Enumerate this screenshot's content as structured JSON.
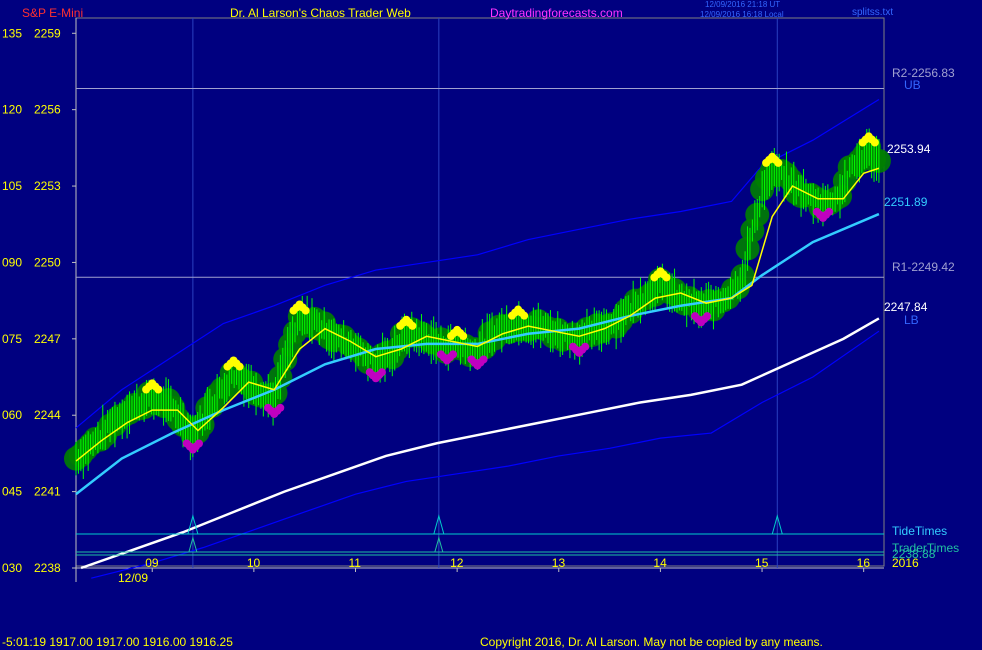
{
  "header": {
    "instrument": "S&P E-Mini",
    "site_title": "Dr. Al Larson's Chaos Trader Web",
    "site_link": "Daytradingforecasts.com",
    "timestamp_ut": "12/09/2016 21:18 UT",
    "timestamp_local": "12/09/2016 16:18 Local",
    "file_name": "splitss.txt"
  },
  "footer": {
    "status_line": "-5:01:19  1917.00 1917.00 1916.00 1916.25",
    "copyright": "Copyright 2016, Dr. Al Larson. May not be copied by any means."
  },
  "colors": {
    "background": "#000080",
    "axis": "#808080",
    "price_candles": "#00ff00",
    "glow": "#008000",
    "upper_dots": "#ffff00",
    "lower_dots": "#c000c0",
    "fast_ema": "#ffff00",
    "mid_ema": "#33ccff",
    "slow_ema": "#ffffff",
    "bands": "#0000ff",
    "pivot_lines": "#a0a0d0",
    "tide_line": "#00cccc",
    "trader_line": "#20c0a0",
    "accent_red": "#ff3030",
    "link_magenta": "#ff33ff"
  },
  "chart_data": {
    "type": "line",
    "title": "S&P E-Mini",
    "x_ticks": [
      "09",
      "10",
      "11",
      "12",
      "13",
      "14",
      "15",
      "16"
    ],
    "x_date_label": "12/09",
    "x_year_label": "2016",
    "xlim": [
      8.25,
      16.2
    ],
    "ylim": [
      2238,
      2259.6
    ],
    "y_ticks": [
      {
        "left": "135",
        "right": "2259",
        "value": 2259
      },
      {
        "left": "120",
        "right": "2256",
        "value": 2256
      },
      {
        "left": "105",
        "right": "2253",
        "value": 2253
      },
      {
        "left": "090",
        "right": "2250",
        "value": 2250
      },
      {
        "left": "075",
        "right": "2247",
        "value": 2247
      },
      {
        "left": "060",
        "right": "2244",
        "value": 2244
      },
      {
        "left": "045",
        "right": "2241",
        "value": 2241
      },
      {
        "left": "030",
        "right": "2238",
        "value": 2238
      }
    ],
    "pivot_levels": [
      {
        "label": "R2-2256.83",
        "value": 2256.83
      },
      {
        "label": "R1-2249.42",
        "value": 2249.42
      }
    ],
    "band_labels": {
      "upper": "UB",
      "lower": "LB"
    },
    "series": [
      {
        "name": "price",
        "label": "2253.94",
        "x": [
          8.25,
          8.4,
          8.6,
          8.8,
          9.0,
          9.2,
          9.4,
          9.6,
          9.8,
          10.0,
          10.2,
          10.3,
          10.45,
          10.6,
          10.8,
          11.0,
          11.2,
          11.35,
          11.5,
          11.7,
          11.9,
          12.0,
          12.2,
          12.4,
          12.6,
          12.8,
          13.0,
          13.2,
          13.4,
          13.6,
          13.8,
          14.0,
          14.2,
          14.4,
          14.6,
          14.8,
          15.0,
          15.1,
          15.25,
          15.45,
          15.6,
          15.75,
          15.9,
          16.05,
          16.15
        ],
        "values": [
          2242.3,
          2242.8,
          2243.7,
          2244.3,
          2244.7,
          2244.3,
          2243.2,
          2244.6,
          2245.6,
          2245.1,
          2244.6,
          2246.1,
          2247.8,
          2247.7,
          2247.0,
          2246.7,
          2246.0,
          2246.4,
          2247.2,
          2247.0,
          2246.7,
          2246.8,
          2246.5,
          2247.4,
          2247.6,
          2247.5,
          2247.2,
          2247.0,
          2247.4,
          2247.8,
          2248.6,
          2249.1,
          2248.5,
          2248.2,
          2248.5,
          2249.4,
          2252.8,
          2253.6,
          2253.2,
          2252.6,
          2252.3,
          2252.6,
          2253.8,
          2254.4,
          2253.9
        ]
      },
      {
        "name": "fast EMA",
        "x": [
          8.25,
          8.5,
          8.75,
          9.0,
          9.25,
          9.45,
          9.7,
          9.95,
          10.2,
          10.45,
          10.7,
          10.95,
          11.2,
          11.45,
          11.7,
          11.95,
          12.2,
          12.45,
          12.7,
          12.95,
          13.2,
          13.45,
          13.7,
          13.95,
          14.2,
          14.45,
          14.7,
          14.9,
          15.1,
          15.3,
          15.55,
          15.8,
          16.0,
          16.15
        ],
        "values": [
          2242.2,
          2243.0,
          2243.7,
          2244.2,
          2244.2,
          2243.4,
          2244.3,
          2245.3,
          2245.0,
          2246.6,
          2247.4,
          2246.9,
          2246.3,
          2246.6,
          2247.1,
          2246.9,
          2246.7,
          2247.2,
          2247.5,
          2247.3,
          2247.1,
          2247.4,
          2247.9,
          2248.6,
          2248.8,
          2248.4,
          2248.6,
          2249.1,
          2251.8,
          2253.0,
          2252.5,
          2252.5,
          2253.5,
          2253.7
        ]
      },
      {
        "name": "mid EMA",
        "label": "2251.89",
        "x": [
          8.25,
          8.7,
          9.2,
          9.7,
          10.2,
          10.7,
          11.2,
          11.7,
          12.2,
          12.7,
          13.2,
          13.7,
          14.2,
          14.7,
          15.0,
          15.5,
          16.15
        ],
        "values": [
          2240.9,
          2242.3,
          2243.3,
          2244.2,
          2245.0,
          2246.0,
          2246.6,
          2246.8,
          2246.8,
          2247.2,
          2247.4,
          2247.9,
          2248.3,
          2248.6,
          2249.5,
          2250.8,
          2251.9
        ]
      },
      {
        "name": "slow EMA",
        "label": "2247.84",
        "x": [
          8.3,
          8.8,
          9.3,
          9.8,
          10.3,
          10.8,
          11.3,
          11.8,
          12.3,
          12.8,
          13.3,
          13.8,
          14.3,
          14.8,
          15.3,
          15.8,
          16.15
        ],
        "values": [
          2238.0,
          2238.7,
          2239.4,
          2240.2,
          2241.0,
          2241.7,
          2242.4,
          2242.9,
          2243.3,
          2243.7,
          2244.1,
          2244.5,
          2244.8,
          2245.2,
          2246.1,
          2247.0,
          2247.8
        ]
      },
      {
        "name": "upper band",
        "x": [
          8.25,
          8.7,
          9.2,
          9.7,
          10.2,
          10.7,
          11.2,
          11.7,
          12.2,
          12.7,
          13.2,
          13.7,
          14.2,
          14.7,
          15.0,
          15.5,
          16.15
        ],
        "values": [
          2243.5,
          2245.0,
          2246.3,
          2247.6,
          2248.3,
          2249.1,
          2249.7,
          2250.0,
          2250.3,
          2250.9,
          2251.3,
          2251.7,
          2252.0,
          2252.4,
          2253.8,
          2254.8,
          2256.4
        ]
      },
      {
        "name": "lower band",
        "x": [
          8.4,
          9.0,
          9.5,
          10.0,
          10.5,
          11.0,
          11.5,
          12.0,
          12.5,
          13.0,
          13.5,
          14.0,
          14.5,
          15.0,
          15.5,
          16.15
        ],
        "values": [
          2237.6,
          2238.2,
          2238.8,
          2239.5,
          2240.2,
          2240.9,
          2241.4,
          2241.7,
          2242.0,
          2242.4,
          2242.7,
          2243.1,
          2243.3,
          2244.5,
          2245.5,
          2247.3
        ]
      }
    ],
    "tide_times": {
      "label": "TideTimes",
      "spikes_x": [
        9.4,
        11.82,
        15.15
      ]
    },
    "trader_times": {
      "label": "TraderTimes",
      "value_label": "2238.88",
      "spikes_x": [
        9.4,
        11.82
      ]
    }
  }
}
